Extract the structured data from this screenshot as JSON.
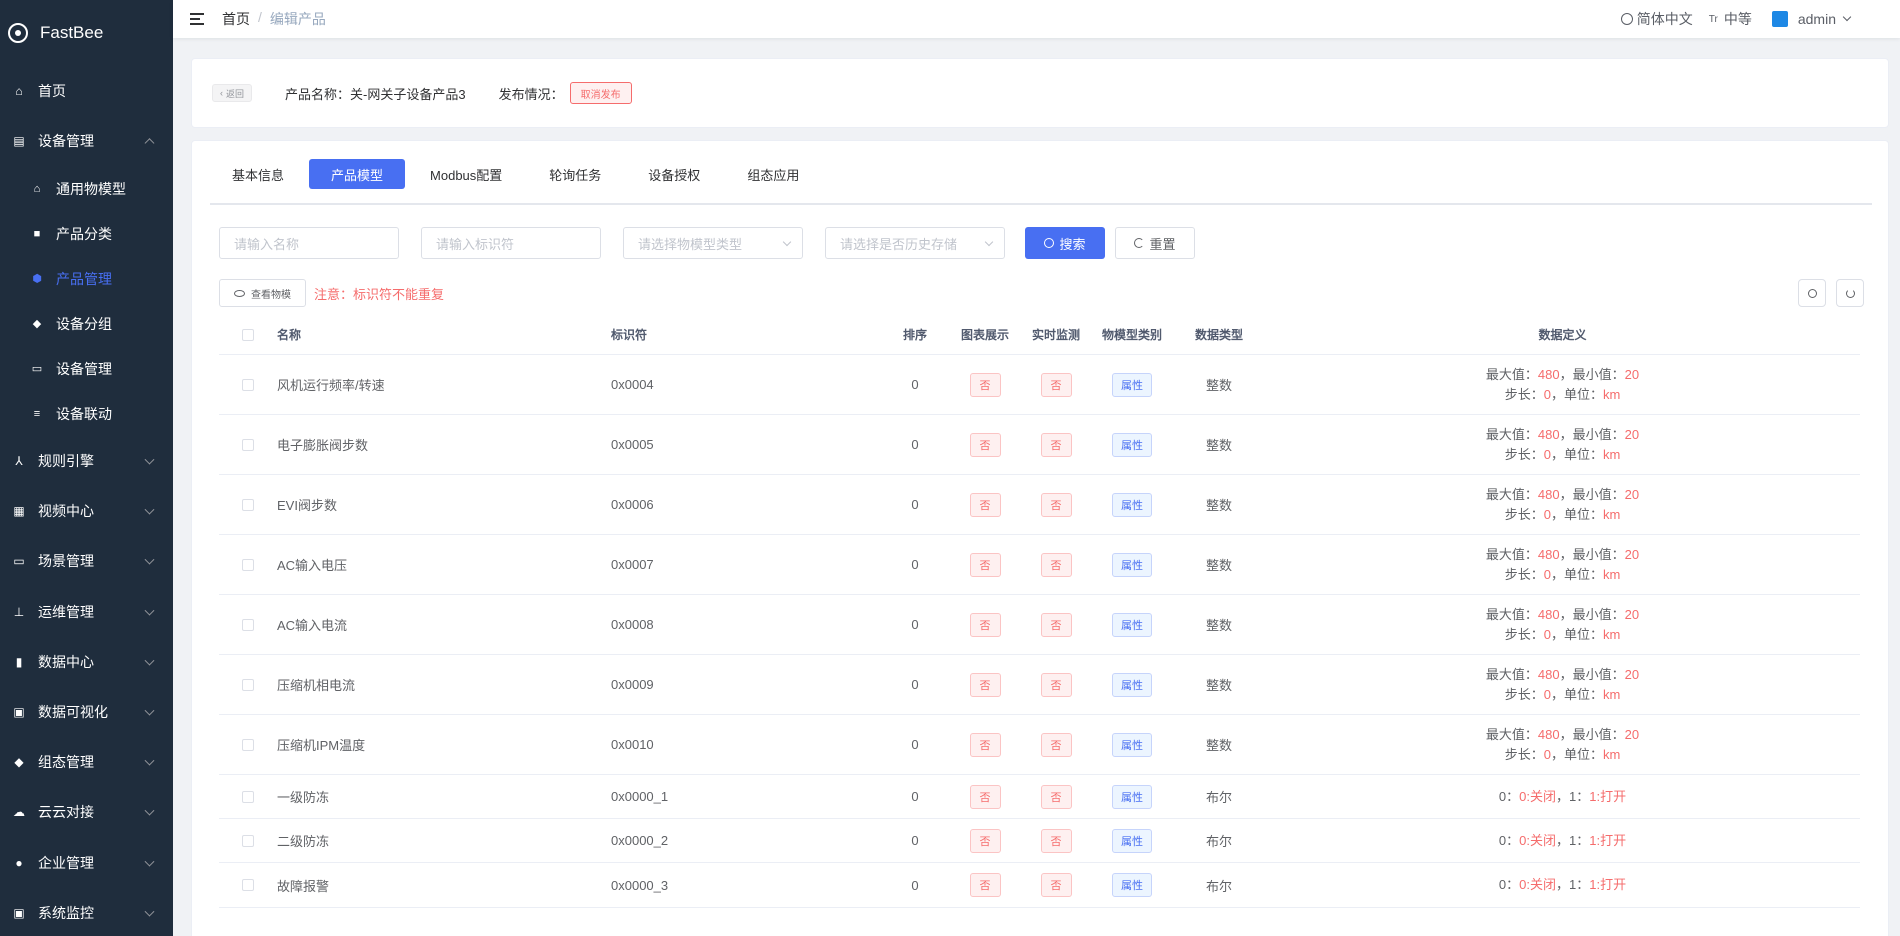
{
  "sidebar": {
    "logo": "FastBee",
    "home": "首页",
    "device_mgmt": "设备管理",
    "sub": [
      {
        "label": "通用物模型",
        "icon": "⌂"
      },
      {
        "label": "产品分类",
        "icon": "■"
      },
      {
        "label": "产品管理",
        "icon": "⬢"
      },
      {
        "label": "设备分组",
        "icon": "◆"
      },
      {
        "label": "设备管理",
        "icon": "▭"
      },
      {
        "label": "设备联动",
        "icon": "≡"
      }
    ],
    "groups": [
      {
        "label": "规则引擎",
        "icon": "⅄"
      },
      {
        "label": "视频中心",
        "icon": "▦"
      },
      {
        "label": "场景管理",
        "icon": "▭"
      },
      {
        "label": "运维管理",
        "icon": "⊥"
      },
      {
        "label": "数据中心",
        "icon": "▮"
      },
      {
        "label": "数据可视化",
        "icon": "▣"
      },
      {
        "label": "组态管理",
        "icon": "◆"
      },
      {
        "label": "云云对接",
        "icon": "☁"
      },
      {
        "label": "企业管理",
        "icon": "●"
      },
      {
        "label": "系统监控",
        "icon": "▣"
      }
    ]
  },
  "navbar": {
    "breadcrumb_home": "首页",
    "breadcrumb_sep": "/",
    "breadcrumb_current": "编辑产品",
    "language": "简体中文",
    "size_icon": "Tr",
    "size": "中等",
    "user": "admin"
  },
  "header": {
    "back": "返回",
    "product_name": "产品名称：关-网关子设备产品3",
    "publish_label": "发布情况：",
    "publish_tag": "取消发布"
  },
  "tabs": [
    "基本信息",
    "产品模型",
    "Modbus配置",
    "轮询任务",
    "设备授权",
    "组态应用"
  ],
  "filters": {
    "name_placeholder": "请输入名称",
    "id_placeholder": "请输入标识符",
    "type_placeholder": "请选择物模型类型",
    "history_placeholder": "请选择是否历史存储",
    "search": "搜索",
    "reset": "重置"
  },
  "toolbar": {
    "view": "查看物模",
    "notice": "注意：标识符不能重复"
  },
  "table": {
    "headers": {
      "name": "名称",
      "identifier": "标识符",
      "order": "排序",
      "chart": "图表展示",
      "monitor": "实时监测",
      "type": "物模型类别",
      "dtype": "数据类型",
      "def": "数据定义"
    },
    "rows": [
      {
        "name": "风机运行频率/转速",
        "id": "0x0004",
        "order": "0",
        "chart": "否",
        "monitor": "否",
        "type": "属性",
        "dtype": "整数",
        "max_label": "最大值：",
        "max": "480",
        "min_label": "，最小值：",
        "min": "20",
        "step_label": "步长：",
        "step": "0",
        "unit_label": "，单位：",
        "unit": "km"
      },
      {
        "name": "电子膨胀阀步数",
        "id": "0x0005",
        "order": "0",
        "chart": "否",
        "monitor": "否",
        "type": "属性",
        "dtype": "整数",
        "max_label": "最大值：",
        "max": "480",
        "min_label": "，最小值：",
        "min": "20",
        "step_label": "步长：",
        "step": "0",
        "unit_label": "，单位：",
        "unit": "km"
      },
      {
        "name": "EVI阀步数",
        "id": "0x0006",
        "order": "0",
        "chart": "否",
        "monitor": "否",
        "type": "属性",
        "dtype": "整数",
        "max_label": "最大值：",
        "max": "480",
        "min_label": "，最小值：",
        "min": "20",
        "step_label": "步长：",
        "step": "0",
        "unit_label": "，单位：",
        "unit": "km"
      },
      {
        "name": "AC输入电压",
        "id": "0x0007",
        "order": "0",
        "chart": "否",
        "monitor": "否",
        "type": "属性",
        "dtype": "整数",
        "max_label": "最大值：",
        "max": "480",
        "min_label": "，最小值：",
        "min": "20",
        "step_label": "步长：",
        "step": "0",
        "unit_label": "，单位：",
        "unit": "km"
      },
      {
        "name": "AC输入电流",
        "id": "0x0008",
        "order": "0",
        "chart": "否",
        "monitor": "否",
        "type": "属性",
        "dtype": "整数",
        "max_label": "最大值：",
        "max": "480",
        "min_label": "，最小值：",
        "min": "20",
        "step_label": "步长：",
        "step": "0",
        "unit_label": "，单位：",
        "unit": "km"
      },
      {
        "name": "压缩机相电流",
        "id": "0x0009",
        "order": "0",
        "chart": "否",
        "monitor": "否",
        "type": "属性",
        "dtype": "整数",
        "max_label": "最大值：",
        "max": "480",
        "min_label": "，最小值：",
        "min": "20",
        "step_label": "步长：",
        "step": "0",
        "unit_label": "，单位：",
        "unit": "km"
      },
      {
        "name": "压缩机IPM温度",
        "id": "0x0010",
        "order": "0",
        "chart": "否",
        "monitor": "否",
        "type": "属性",
        "dtype": "整数",
        "max_label": "最大值：",
        "max": "480",
        "min_label": "，最小值：",
        "min": "20",
        "step_label": "步长：",
        "step": "0",
        "unit_label": "，单位：",
        "unit": "km"
      }
    ],
    "bool_rows": [
      {
        "name": "一级防冻",
        "id": "0x0000_1",
        "order": "0",
        "chart": "否",
        "monitor": "否",
        "type": "属性",
        "dtype": "布尔",
        "k0": "0：",
        "v0": "0:关闭",
        "sep": "，",
        "k1": "1：",
        "v1": "1:打开"
      },
      {
        "name": "二级防冻",
        "id": "0x0000_2",
        "order": "0",
        "chart": "否",
        "monitor": "否",
        "type": "属性",
        "dtype": "布尔",
        "k0": "0：",
        "v0": "0:关闭",
        "sep": "，",
        "k1": "1：",
        "v1": "1:打开"
      },
      {
        "name": "故障报警",
        "id": "0x0000_3",
        "order": "0",
        "chart": "否",
        "monitor": "否",
        "type": "属性",
        "dtype": "布尔",
        "k0": "0：",
        "v0": "0:关闭",
        "sep": "，",
        "k1": "1：",
        "v1": "1:打开"
      }
    ]
  }
}
